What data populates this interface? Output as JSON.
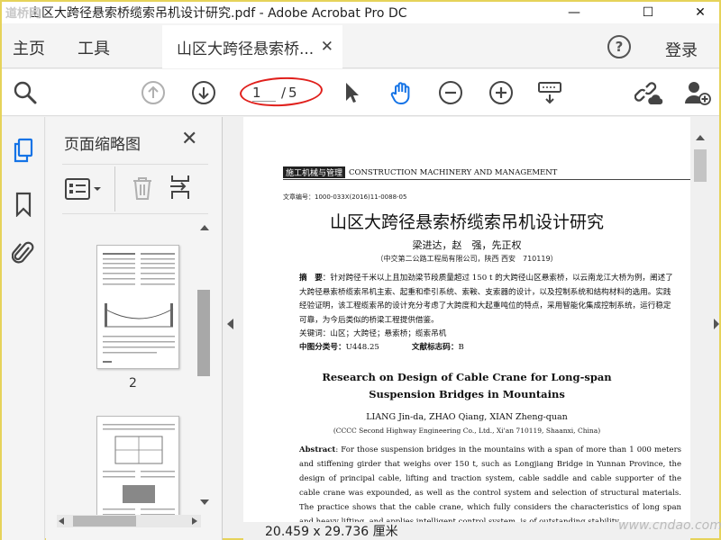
{
  "window": {
    "title": "山区大跨径悬索桥缆索吊机设计研究.pdf - Adobe Acrobat Pro DC",
    "watermark_top": "道桥网",
    "minimize": "—",
    "maximize": "☐",
    "close": "✕"
  },
  "menu": {
    "home": "主页",
    "tools": "工具",
    "tab_title": "山区大跨径悬索桥...",
    "tab_close": "✕",
    "help": "?",
    "login": "登录"
  },
  "toolbar": {
    "page_current": "1",
    "page_separator": "/",
    "page_total": "5"
  },
  "panel": {
    "title": "页面缩略图",
    "close": "✕",
    "thumb_label": "2"
  },
  "status": {
    "dimensions": "20.459 x 29.736 厘米",
    "watermark": "www.cndao.com"
  },
  "pdf": {
    "journal_cn": "施工机械与管理",
    "journal_en": "CONSTRUCTION MACHINERY AND MANAGEMENT",
    "article_no": "文章编号：1000-033X(2016)11-0088-05",
    "title_cn": "山区大跨径悬索桥缆索吊机设计研究",
    "authors_cn": "梁进达，赵　强，先正权",
    "affiliation_cn": "（中交第二公路工程局有限公司，陕西 西安　710119）",
    "abstract_cn_label": "摘　要",
    "abstract_cn": "：针对跨径千米以上且加劲梁节段质量超过 150 t 的大跨径山区悬索桥，以云南龙江大桥为例，阐述了大跨径悬索桥缆索吊机主索、起重和牵引系统、索鞍、支索器的设计，以及控制系统和结构材料的选用。实践经验证明，该工程缆索吊的设计充分考虑了大跨度和大起重吨位的特点，采用智能化集成控制系统，运行稳定可靠，为今后类似的桥梁工程提供借鉴。",
    "keywords_cn": "关键词：山区；大跨径；悬索桥；缆索吊机",
    "cls_label": "中图分类号：",
    "cls_value": "U448.25",
    "code_label": "文献标志码：",
    "code_value": "B",
    "title_en_1": "Research on Design of Cable Crane for Long-span",
    "title_en_2": "Suspension Bridges in Mountains",
    "authors_en": "LIANG Jin-da, ZHAO Qiang, XIAN Zheng-quan",
    "affiliation_en": "(CCCC Second Highway Engineering Co., Ltd., Xi'an 710119, Shaanxi, China)",
    "abstract_en_label": "Abstract",
    "abstract_en": ": For those suspension bridges in the mountains with a span of more than 1 000 meters and stiffening girder that weighs over 150 t, such as Longjiang Bridge in Yunnan Province, the design of principal cable, lifting and traction system, cable saddle and cable supporter of the cable crane was expounded, as well as the control system and selection of structural materials. The practice shows that the cable crane, which fully considers the characteristics of long span and heavy lifting, and applies intelligent control system, is of outstanding stability"
  },
  "colors": {
    "accent_blue": "#1473e6",
    "icon_gray": "#444444",
    "disabled_gray": "#b0b0b0",
    "annotation_red": "#e0201c"
  }
}
